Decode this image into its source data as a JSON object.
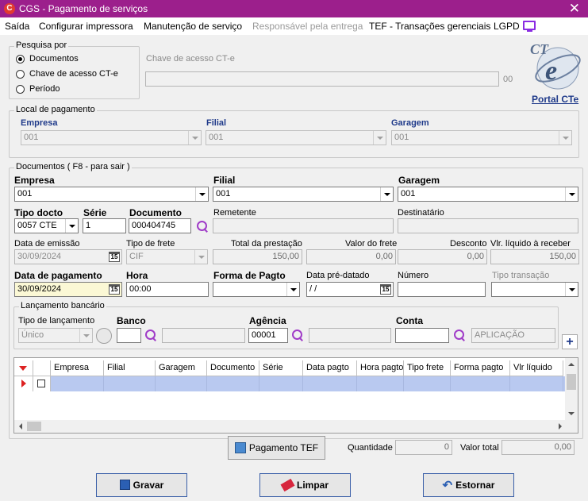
{
  "window": {
    "title": "CGS - Pagamento de serviços",
    "close_glyph": "✕"
  },
  "menu": {
    "items": [
      "Saída",
      "Configurar impressora",
      "Manutenção de serviço",
      "Responsável pela entrega",
      "TEF - Transações gerenciais",
      "LGPD"
    ],
    "disabled_index": 3
  },
  "pesquisa": {
    "title": "Pesquisa por",
    "options": [
      "Documentos",
      "Chave de acesso CT-e",
      "Período"
    ],
    "selected": "Documentos",
    "chave_label": "Chave de acesso CT-e",
    "chave_value": "",
    "chave_suffix": "00"
  },
  "portal": {
    "logo_text": "CTe",
    "link": "Portal CTe"
  },
  "local": {
    "title": "Local de pagamento",
    "empresa_label": "Empresa",
    "empresa_value": "001",
    "filial_label": "Filial",
    "filial_value": "001",
    "garagem_label": "Garagem",
    "garagem_value": "001"
  },
  "docs": {
    "title": "Documentos ( F8 - para sair )",
    "empresa_label": "Empresa",
    "empresa_value": "001",
    "filial_label": "Filial",
    "filial_value": "001",
    "garagem_label": "Garagem",
    "garagem_value": "001",
    "tipo_docto_label": "Tipo docto",
    "tipo_docto_value": "0057 CTE",
    "serie_label": "Série",
    "serie_value": "1",
    "documento_label": "Documento",
    "documento_value": "000404745",
    "remetente_label": "Remetente",
    "remetente_value": "",
    "destinatario_label": "Destinatário",
    "destinatario_value": "",
    "emissao_label": "Data de emissão",
    "emissao_value": "30/09/2024",
    "frete_label": "Tipo de frete",
    "frete_value": "CIF",
    "total_prest_label": "Total da prestação",
    "total_prest_value": "150,00",
    "valor_frete_label": "Valor do frete",
    "valor_frete_value": "0,00",
    "desconto_label": "Desconto",
    "desconto_value": "0,00",
    "liquido_label": "Vlr. líquido à receber",
    "liquido_value": "150,00",
    "data_pag_label": "Data de pagamento",
    "data_pag_value": "30/09/2024",
    "hora_label": "Hora",
    "hora_value": "00:00",
    "forma_label": "Forma de Pagto",
    "forma_value": "",
    "pre_datado_label": "Data pré-datado",
    "pre_datado_value": " / /",
    "numero_label": "Número",
    "numero_value": "",
    "tipo_trans_label": "Tipo transação",
    "tipo_trans_value": "",
    "cal_label": "15"
  },
  "bancario": {
    "title": "Lançamento bancário",
    "tipo_label": "Tipo de lançamento",
    "tipo_value": "Único",
    "banco_label": "Banco",
    "banco_value": "",
    "banco_nome": "",
    "agencia_label": "Agência",
    "agencia_value": "00001",
    "agencia_nome": "",
    "conta_label": "Conta",
    "conta_value": "",
    "conta_nome": "APLICAÇÃO",
    "add_glyph": "+"
  },
  "grid": {
    "columns": [
      "Empresa",
      "Filial",
      "Garagem",
      "Documento",
      "Série",
      "Data pagto",
      "Hora pagto",
      "Tipo frete",
      "Forma pagto",
      "Vlr líquido"
    ]
  },
  "footer": {
    "pagamento_tef": "Pagamento TEF",
    "quantidade_label": "Quantidade",
    "quantidade_value": "0",
    "valor_total_label": "Valor total",
    "valor_total_value": "0,00"
  },
  "actions": {
    "gravar": "Gravar",
    "limpar": "Limpar",
    "estornar": "Estornar"
  },
  "colors": {
    "titlebar": "#9c1f8c",
    "accent": "#a03cc8",
    "link": "#1f3a8a",
    "selected_row": "#b9c9f0"
  }
}
